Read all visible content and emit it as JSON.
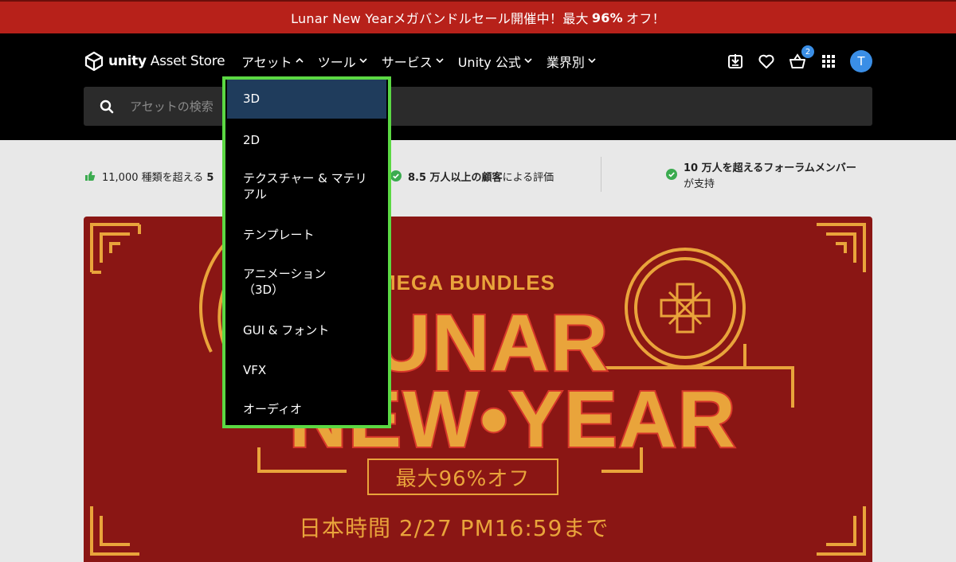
{
  "promo": {
    "text_pre": "Lunar New Yearメガバンドルセール開催中！最大",
    "text_bold": "96%",
    "text_post": "オフ！"
  },
  "header": {
    "logo_brand": "unity",
    "logo_product": "Asset Store",
    "nav": [
      {
        "label": "アセット",
        "chevron": "up"
      },
      {
        "label": "ツール",
        "chevron": "down"
      },
      {
        "label": "サービス",
        "chevron": "down"
      },
      {
        "label": "Unity 公式",
        "chevron": "down"
      },
      {
        "label": "業界別",
        "chevron": "down"
      }
    ],
    "cart_count": "2",
    "avatar_letter": "T",
    "icons": [
      "download-icon",
      "heart-icon",
      "cart-icon",
      "grid-icon"
    ]
  },
  "search": {
    "placeholder": "アセットの検索"
  },
  "trust": {
    "item1_pre": "11,000 種類を超える",
    "item1_bold": "5",
    "item2_bold": "8.5 万人以上の顧客",
    "item2_post": "による評価",
    "item3_bold": "10 万人を超えるフォーラムメンバー",
    "item3_post": "が支持"
  },
  "banner": {
    "sub": "MEGA BUNDLES",
    "title1": "LUNAR",
    "title2": "NEW•YEAR",
    "discount": "最大96%オフ",
    "date": "日本時間 2/27 PM16:59まで"
  },
  "dropdown": {
    "items": [
      {
        "label": "3D",
        "active": true
      },
      {
        "label": "2D"
      },
      {
        "label": "テクスチャー & マテリアル"
      },
      {
        "label": "テンプレート"
      },
      {
        "label": "アニメーション（3D）"
      },
      {
        "label": "GUI & フォント"
      },
      {
        "label": "VFX"
      },
      {
        "label": "オーディオ"
      }
    ]
  },
  "colors": {
    "promo_bg": "#b7211a",
    "accent_blue": "#3a8ee6",
    "dropdown_border": "#5bd843",
    "banner_bg": "#8a1614",
    "banner_gold": "#e9a43b"
  }
}
